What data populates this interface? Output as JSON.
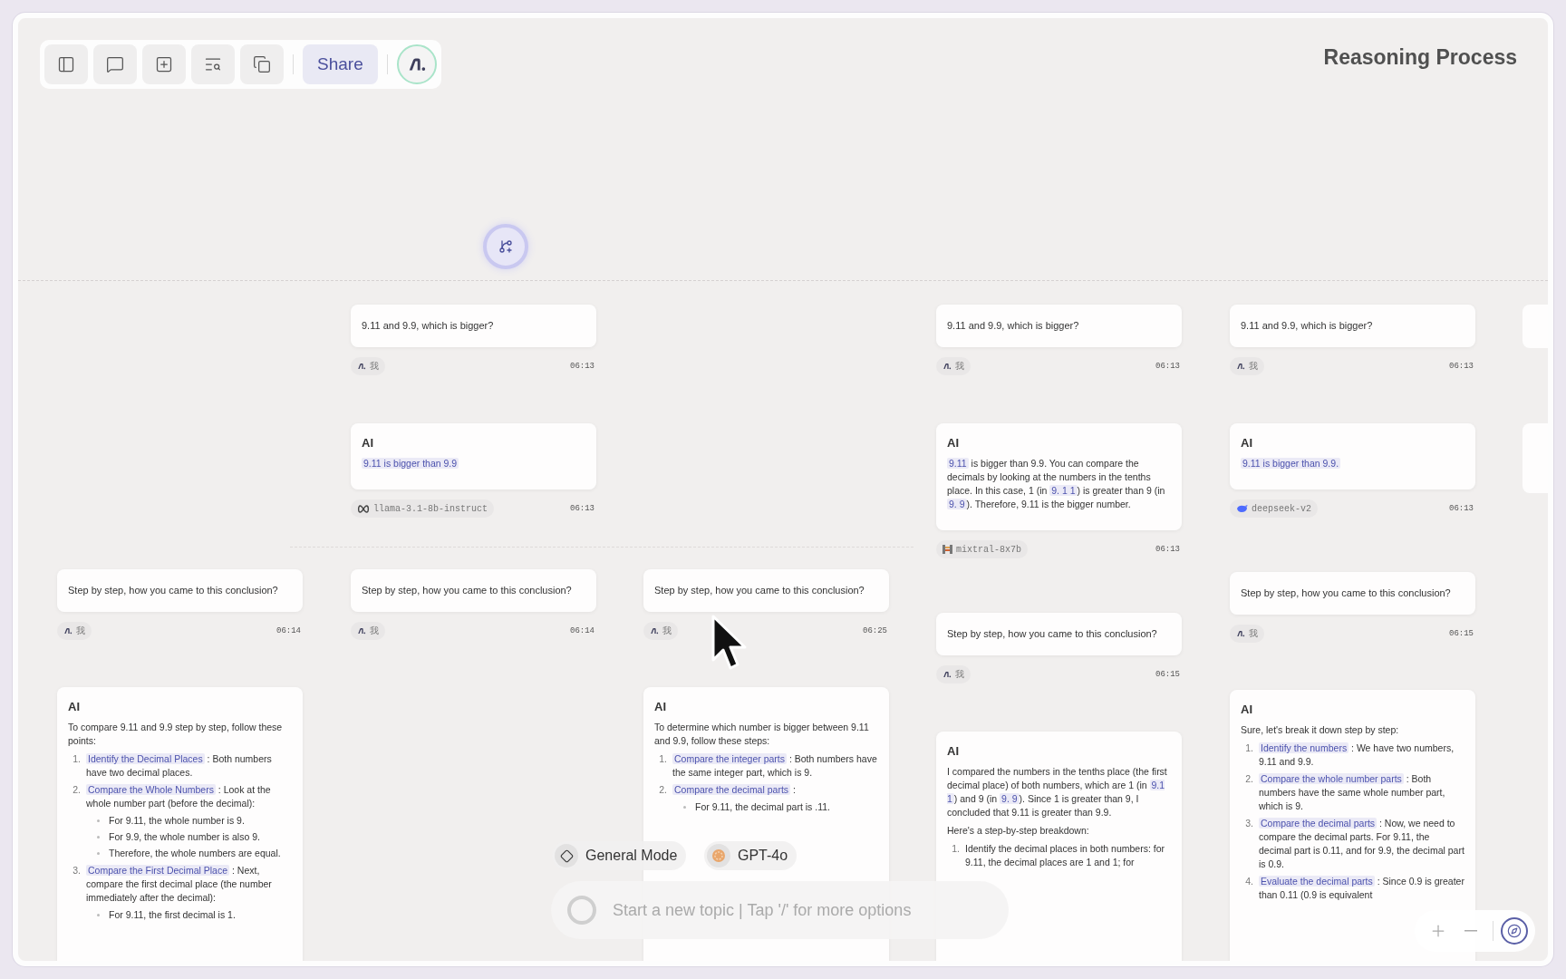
{
  "title": "Reasoning Process",
  "toolbar": {
    "tools": [
      {
        "kind": "sidebar"
      },
      {
        "kind": "comment"
      },
      {
        "kind": "new"
      },
      {
        "kind": "search"
      },
      {
        "kind": "copy"
      }
    ],
    "share": "Share"
  },
  "columns": [
    [
      {
        "kind": "question",
        "text": "Step by step, how you came to this conclusion?",
        "author": {
          "kind": "user",
          "label": "我"
        },
        "time": "06:14"
      },
      {
        "kind": "answer",
        "title": "AI",
        "blocks": [
          {
            "kind": "p",
            "segments": [
              {
                "text": "To compare 9.11 and 9.9 step by step, follow these points:",
                "highlight": false
              }
            ]
          },
          {
            "kind": "ol",
            "items": [
              {
                "number": "1.",
                "segments": [
                  {
                    "text": "Identify the Decimal Places",
                    "highlight": true
                  },
                  {
                    "text": " : Both numbers have two decimal places.",
                    "highlight": false
                  }
                ]
              },
              {
                "number": "2.",
                "segments": [
                  {
                    "text": "Compare the Whole Numbers",
                    "highlight": true
                  },
                  {
                    "text": " : Look at the whole number part (before the decimal):",
                    "highlight": false
                  }
                ],
                "children": [
                  "For 9.11, the whole number is 9.",
                  "For 9.9, the whole number is also 9.",
                  "Therefore, the whole numbers are equal."
                ]
              },
              {
                "number": "3.",
                "segments": [
                  {
                    "text": "Compare the First Decimal Place",
                    "highlight": true
                  },
                  {
                    "text": " : Next, compare the first decimal place (the number immediately after the decimal):",
                    "highlight": false
                  }
                ],
                "children": [
                  "For 9.11, the first decimal is 1."
                ]
              }
            ]
          }
        ]
      }
    ],
    [
      {
        "kind": "question",
        "text": "9.11 and 9.9, which is bigger?",
        "author": {
          "kind": "user",
          "label": "我"
        },
        "time": "06:13"
      },
      {
        "kind": "answer",
        "title": "AI",
        "blocks": [
          {
            "kind": "p",
            "segments": [
              {
                "text": "9.11 is bigger than 9.9",
                "highlight": true
              }
            ]
          }
        ],
        "author": {
          "kind": "meta",
          "label": "llama-3.1-8b-instruct"
        },
        "time": "06:13"
      },
      {
        "kind": "question",
        "text": "Step by step, how you came to this conclusion?",
        "author": {
          "kind": "user",
          "label": "我"
        },
        "time": "06:14"
      }
    ],
    [
      {
        "kind": "question",
        "text": "Step by step, how you came to this conclusion?",
        "author": {
          "kind": "user",
          "label": "我"
        },
        "time": "06:25"
      },
      {
        "kind": "answer",
        "title": "AI",
        "blocks": [
          {
            "kind": "p",
            "segments": [
              {
                "text": "To determine which number is bigger between 9.11 and 9.9, follow these steps:",
                "highlight": false
              }
            ]
          },
          {
            "kind": "ol",
            "items": [
              {
                "number": "1.",
                "segments": [
                  {
                    "text": "Compare the integer parts",
                    "highlight": true
                  },
                  {
                    "text": " : Both numbers have the same integer part, which is 9.",
                    "highlight": false
                  }
                ]
              },
              {
                "number": "2.",
                "segments": [
                  {
                    "text": "Compare the decimal parts",
                    "highlight": true
                  },
                  {
                    "text": " :",
                    "highlight": false
                  }
                ],
                "children": [
                  "For 9.11, the decimal part is .11."
                ]
              }
            ]
          }
        ]
      }
    ],
    [
      {
        "kind": "question",
        "text": "9.11 and 9.9, which is bigger?",
        "author": {
          "kind": "user",
          "label": "我"
        },
        "time": "06:13"
      },
      {
        "kind": "answer",
        "title": "AI",
        "blocks": [
          {
            "kind": "p",
            "segments": [
              {
                "text": "9.11",
                "highlight": true
              },
              {
                "text": " is bigger than 9.9. You can compare the decimals by looking at the numbers in the tenths place. In this case, 1 (in ",
                "highlight": false
              },
              {
                "text": "9. 1 1",
                "highlight": true
              },
              {
                "text": ") is greater than 9 (in ",
                "highlight": false
              },
              {
                "text": "9. 9",
                "highlight": true
              },
              {
                "text": "). Therefore, 9.11 is the bigger number.",
                "highlight": false
              }
            ]
          }
        ],
        "author": {
          "kind": "mistral",
          "label": "mixtral-8x7b"
        },
        "time": "06:13"
      },
      {
        "kind": "question",
        "text": "Step by step, how you came to this conclusion?",
        "author": {
          "kind": "user",
          "label": "我"
        },
        "time": "06:15"
      },
      {
        "kind": "answer",
        "title": "AI",
        "blocks": [
          {
            "kind": "p",
            "segments": [
              {
                "text": "I compared the numbers in the tenths place (the first decimal place) of both numbers, which are 1 (in ",
                "highlight": false
              },
              {
                "text": "9.1 1",
                "highlight": true
              },
              {
                "text": ") and 9 (in ",
                "highlight": false
              },
              {
                "text": "9. 9",
                "highlight": true
              },
              {
                "text": "). Since 1 is greater than 9, I concluded that 9.11 is greater than 9.9.",
                "highlight": false
              }
            ]
          },
          {
            "kind": "p",
            "segments": [
              {
                "text": "Here's a step-by-step breakdown:",
                "highlight": false
              }
            ]
          },
          {
            "kind": "ol",
            "items": [
              {
                "number": "1.",
                "segments": [
                  {
                    "text": "Identify the decimal places in both numbers: for 9.11, the decimal places are 1 and 1; for",
                    "highlight": false
                  }
                ]
              }
            ]
          }
        ]
      }
    ],
    [
      {
        "kind": "question",
        "text": "9.11 and 9.9, which is bigger?",
        "author": {
          "kind": "user",
          "label": "我"
        },
        "time": "06:13"
      },
      {
        "kind": "answer",
        "title": "AI",
        "blocks": [
          {
            "kind": "p",
            "segments": [
              {
                "text": "9.11 is bigger than 9.9.",
                "highlight": true
              }
            ]
          }
        ],
        "author": {
          "kind": "deepseek",
          "label": "deepseek-v2"
        },
        "time": "06:13"
      },
      {
        "kind": "question",
        "text": "Step by step, how you came to this conclusion?",
        "author": {
          "kind": "user",
          "label": "我"
        },
        "time": "06:15"
      },
      {
        "kind": "answer",
        "title": "AI",
        "blocks": [
          {
            "kind": "p",
            "segments": [
              {
                "text": "Sure, let's break it down step by step:",
                "highlight": false
              }
            ]
          },
          {
            "kind": "ol",
            "items": [
              {
                "number": "1.",
                "segments": [
                  {
                    "text": "Identify the numbers",
                    "highlight": true
                  },
                  {
                    "text": " : We have two numbers, 9.11 and 9.9.",
                    "highlight": false
                  }
                ]
              },
              {
                "number": "2.",
                "segments": [
                  {
                    "text": "Compare the whole number parts",
                    "highlight": true
                  },
                  {
                    "text": " : Both numbers have the same whole number part, which is 9.",
                    "highlight": false
                  }
                ]
              },
              {
                "number": "3.",
                "segments": [
                  {
                    "text": "Compare the decimal parts",
                    "highlight": true
                  },
                  {
                    "text": " : Now, we need to compare the decimal parts. For 9.11, the decimal part is 0.11, and for 9.9, the decimal part is 0.9.",
                    "highlight": false
                  }
                ]
              },
              {
                "number": "4.",
                "segments": [
                  {
                    "text": "Evaluate the decimal parts",
                    "highlight": true
                  },
                  {
                    "text": " : Since 0.9 is greater than 0.11 (0.9 is equivalent",
                    "highlight": false
                  }
                ]
              }
            ]
          }
        ]
      }
    ]
  ],
  "mode": {
    "label": "General Mode"
  },
  "model": {
    "label": "GPT-4o"
  },
  "composer": {
    "placeholder": "Start a new topic | Tap '/' for more options"
  },
  "zoom_controls": [
    {
      "kind": "zoom_in"
    },
    {
      "kind": "zoom_out"
    },
    {
      "kind": "locate"
    }
  ]
}
